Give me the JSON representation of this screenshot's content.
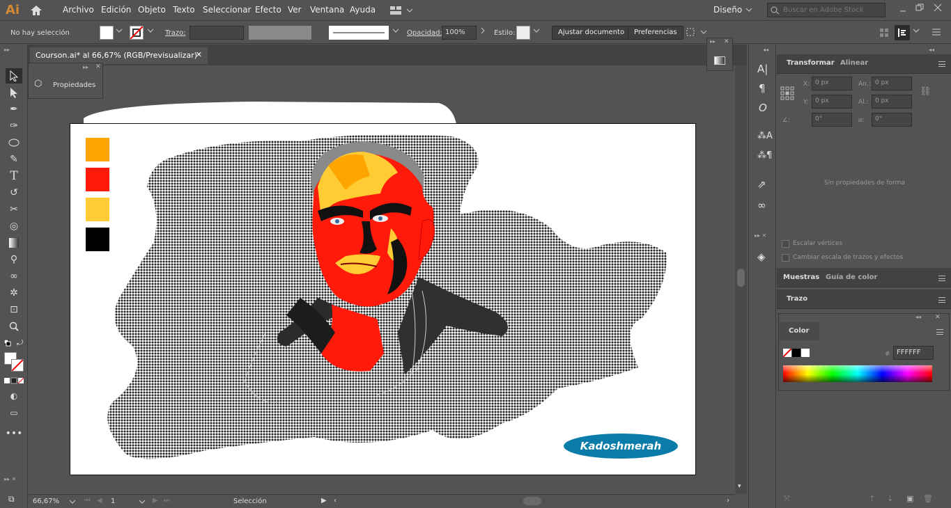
{
  "app": {
    "logo": "Ai"
  },
  "menu": [
    "Archivo",
    "Edición",
    "Objeto",
    "Texto",
    "Seleccionar",
    "Efecto",
    "Ver",
    "Ventana",
    "Ayuda"
  ],
  "workspace": "Diseño",
  "search": {
    "placeholder": "Buscar en Adobe Stock"
  },
  "control": {
    "selection": "No hay selección",
    "trazo_label": "Trazo:",
    "opacity_label": "Opacidad:",
    "opacity_value": "100%",
    "style_label": "Estilo:",
    "fit_button": "Ajustar documento",
    "prefs_button": "Preferencias"
  },
  "document": {
    "tab_title": "Courson.ai* al 66,67% (RGB/Previsualizar)"
  },
  "float_panel": {
    "label": "Propiedades"
  },
  "artwork": {
    "brand_text": "Kadoshmerah",
    "swatches": [
      "#ffa500",
      "#ff1a0a",
      "#ffcc33",
      "#000000"
    ]
  },
  "status": {
    "zoom": "66,67%",
    "page": "1",
    "tool": "Selección"
  },
  "transform_panel": {
    "tabs": [
      "Transformar",
      "Alinear"
    ],
    "x_label": "X:",
    "x_value": "0 px",
    "y_label": "Y:",
    "y_value": "0 px",
    "w_label": "An.:",
    "w_value": "0 px",
    "h_label": "Al.:",
    "h_value": "0 px",
    "angle_value": "0°",
    "shear_value": "0°",
    "empty_message": "Sin propiedades de forma",
    "scale_corners": "Escalar vértices",
    "scale_strokes": "Cambiar escala de trazos y efectos"
  },
  "swatches_panel": {
    "tabs": [
      "Muestras",
      "Guía de color"
    ]
  },
  "stroke_panel": {
    "title": "Trazo"
  },
  "color_panel": {
    "title": "Color",
    "hex_label": "#",
    "hex_value": "FFFFFF"
  },
  "colors": {
    "accent": "#d48a35",
    "ui_bg": "#535353",
    "badge": "#0a7ca9"
  }
}
